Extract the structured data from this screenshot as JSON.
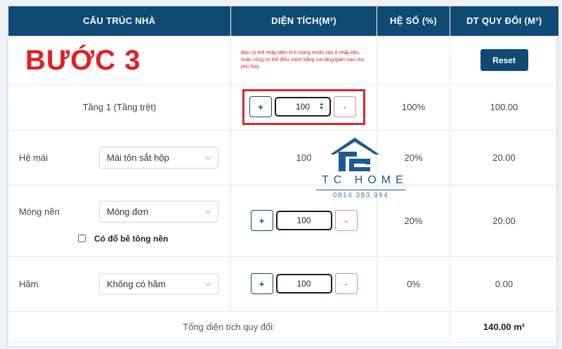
{
  "header": {
    "col_structure": "CẤU TRÚC NHÀ",
    "col_area": "DIỆN TÍCH(M²)",
    "col_coef": "HỆ SỐ (%)",
    "col_converted": "DT QUY ĐỔI (M²)"
  },
  "intro": {
    "step_title": "BƯỚC 3",
    "note": "Bạn có thể nhập diện tích mong muốn vào ô nhập liệu, hoặc cũng có thể điều chỉnh bằng nút tăng/giảm sao cho phù hợp",
    "reset_label": "Reset"
  },
  "rows": {
    "floor1": {
      "label": "Tầng 1 (Tầng trệt)",
      "plus": "+",
      "minus": "-",
      "area": "100",
      "coef": "100%",
      "converted": "100.00"
    },
    "roof": {
      "label": "Hệ mái",
      "select_value": "Mái tôn sắt hộp",
      "area": "100",
      "coef": "20%",
      "converted": "20.00"
    },
    "foundation": {
      "label": "Móng nền",
      "select_value": "Móng đơn",
      "plus": "+",
      "minus": "-",
      "area": "100",
      "coef": "20%",
      "converted": "20.00",
      "checkbox_label": "Có đổ bê tông nền",
      "checkbox_checked": false
    },
    "basement": {
      "label": "Hầm",
      "select_value": "Không có hầm",
      "plus": "+",
      "minus": "-",
      "area": "100",
      "coef": "0%",
      "converted": "0.00"
    }
  },
  "total": {
    "label": "Tổng diện tích quy đổi:",
    "value": "140.00 m²"
  },
  "watermark": {
    "brand": "TC HOME",
    "phone": "0814.383.994"
  },
  "colors": {
    "header_bg": "#0e4a73",
    "highlight": "#d8262e",
    "brand": "#1d5a92"
  }
}
